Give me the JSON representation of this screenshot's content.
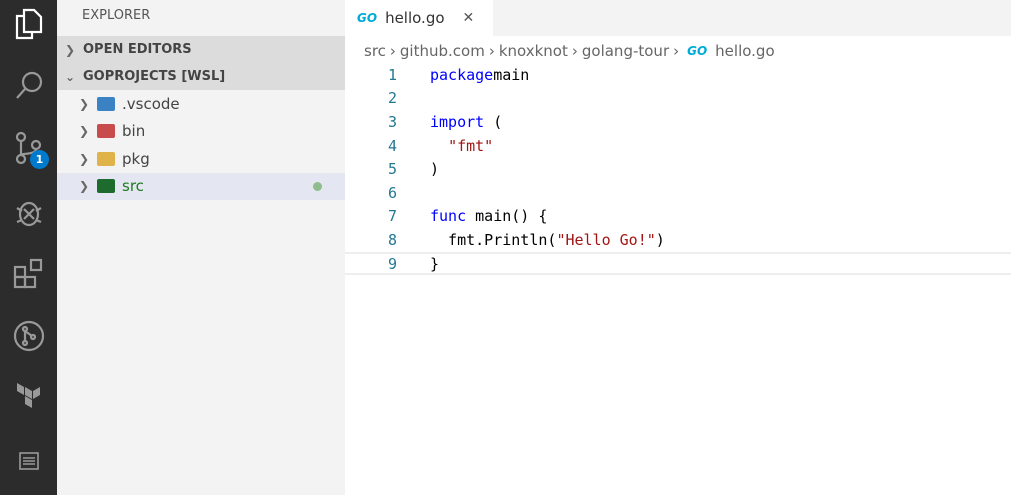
{
  "activity_bar": {
    "items": [
      "explorer-icon",
      "search-icon",
      "source-control-icon",
      "debug-icon",
      "extensions-icon",
      "git-graph-icon",
      "terraform-icon",
      "list-icon"
    ],
    "scm_badge": "1"
  },
  "sidebar": {
    "title": "EXPLORER",
    "sections": [
      {
        "label": "OPEN EDITORS"
      },
      {
        "label": "GOPROJECTS [WSL]"
      }
    ],
    "items": [
      {
        "label": ".vscode",
        "color": "#3b82c4"
      },
      {
        "label": "bin",
        "color": "#c94c4c"
      },
      {
        "label": "pkg",
        "color": "#dfb24a"
      },
      {
        "label": "src",
        "color": "#1e6b2e"
      }
    ]
  },
  "tab": {
    "icon": "GO",
    "label": "hello.go",
    "close": "✕"
  },
  "breadcrumbs": [
    "src",
    "github.com",
    "knoxknot",
    "golang-tour",
    "hello.go"
  ],
  "breadcrumb_sep": "›",
  "code": {
    "lines": [
      [
        [
          "kw",
          "package"
        ],
        [
          "",
          "main"
        ]
      ],
      [],
      [
        [
          "kw",
          "import"
        ],
        [
          "",
          " ("
        ]
      ],
      [
        [
          "",
          "  "
        ],
        [
          "str",
          "\"fmt\""
        ]
      ],
      [
        [
          "",
          ")"
        ]
      ],
      [],
      [
        [
          "kw",
          "func"
        ],
        [
          "",
          " main() {"
        ]
      ],
      [
        [
          "",
          "  fmt.Println("
        ],
        [
          "str",
          "\"Hello Go!\""
        ],
        [
          "",
          ")"
        ]
      ],
      [
        [
          "",
          "}"
        ]
      ]
    ]
  }
}
